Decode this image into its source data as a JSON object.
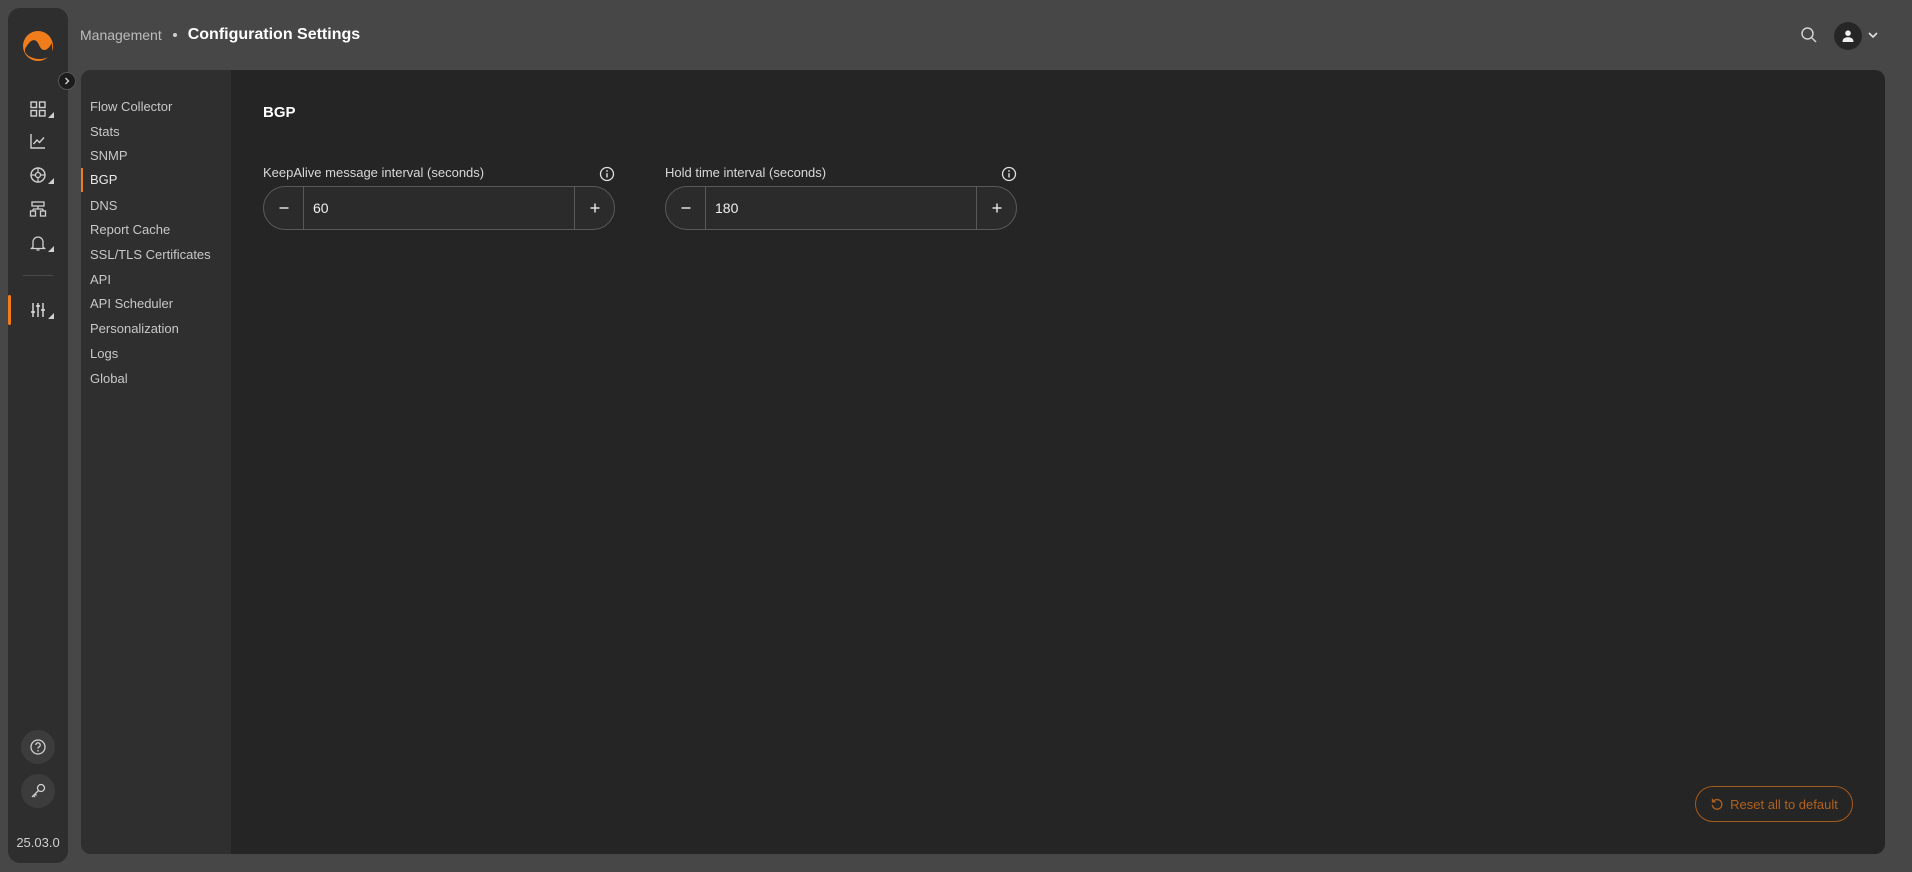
{
  "header": {
    "breadcrumb_parent": "Management",
    "page_title": "Configuration Settings"
  },
  "rail": {
    "version": "25.03.0",
    "icons": [
      "dashboard-icon",
      "analytics-icon",
      "network-icon",
      "topology-icon",
      "alerts-icon",
      "settings-sliders-icon"
    ],
    "active": "settings-sliders-icon",
    "bottom_icons": [
      "help-icon",
      "key-icon"
    ]
  },
  "settings_nav": {
    "items": [
      {
        "label": "Flow Collector"
      },
      {
        "label": "Stats"
      },
      {
        "label": "SNMP"
      },
      {
        "label": "BGP"
      },
      {
        "label": "DNS"
      },
      {
        "label": "Report Cache"
      },
      {
        "label": "SSL/TLS Certificates"
      },
      {
        "label": "API"
      },
      {
        "label": "API Scheduler"
      },
      {
        "label": "Personalization"
      },
      {
        "label": "Logs"
      },
      {
        "label": "Global"
      }
    ],
    "active": "BGP"
  },
  "section": {
    "title": "BGP",
    "fields": [
      {
        "label": "KeepAlive message interval (seconds)",
        "value": "60"
      },
      {
        "label": "Hold time interval (seconds)",
        "value": "180"
      }
    ]
  },
  "actions": {
    "reset_label": "Reset all to default"
  },
  "colors": {
    "accent": "#f07c1b",
    "background": "#474747",
    "panel": "#252525",
    "nav": "#2f2f2f"
  }
}
